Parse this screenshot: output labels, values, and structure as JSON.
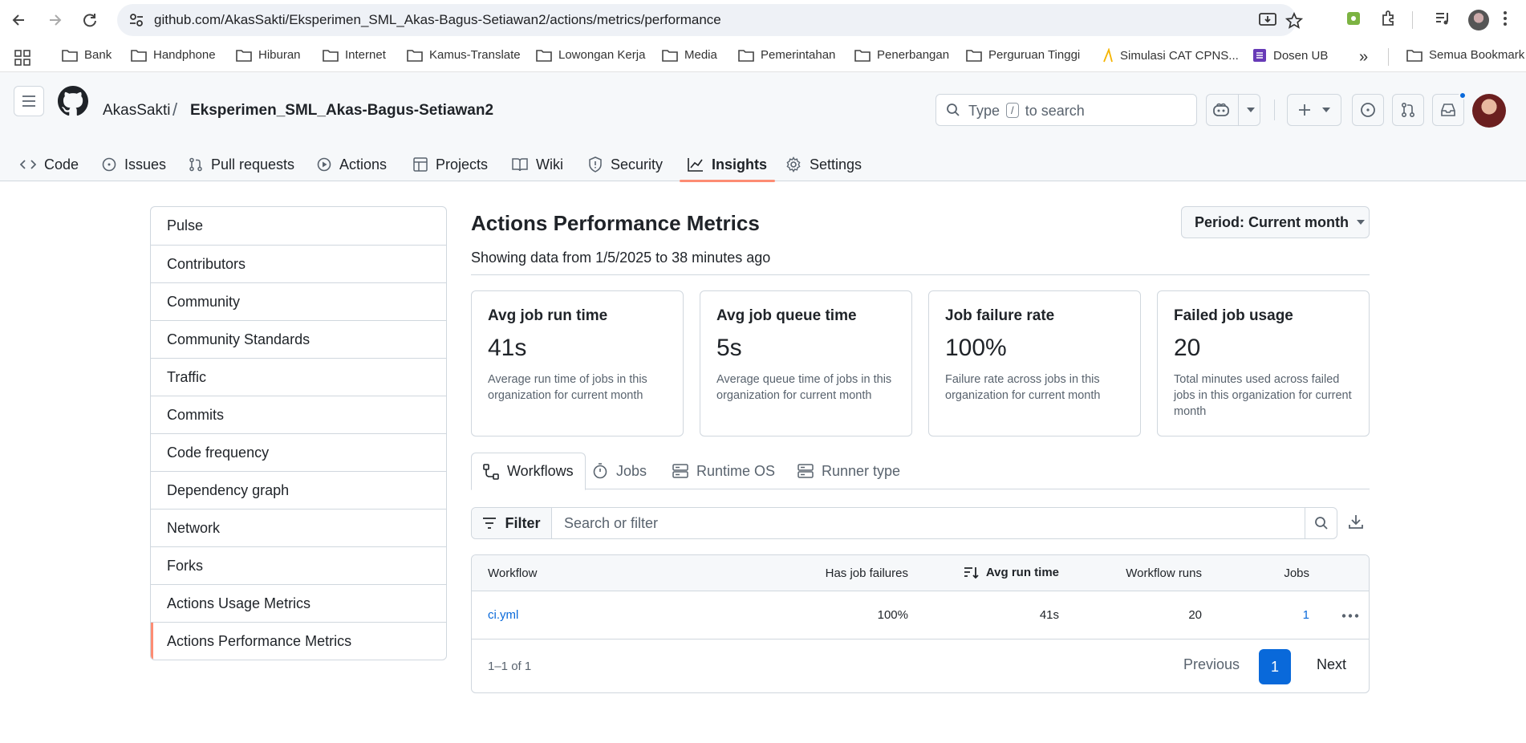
{
  "browser": {
    "url": "github.com/AkasSakti/Eksperimen_SML_Akas-Bagus-Setiawan2/actions/metrics/performance",
    "bookmarks": [
      "Bank",
      "Handphone",
      "Hiburan",
      "Internet",
      "Kamus-Translate",
      "Lowongan Kerja",
      "Media",
      "Pemerintahan",
      "Penerbangan",
      "Perguruan Tinggi",
      "Simulasi CAT CPNS...",
      "Dosen UB"
    ],
    "bookmarks_overflow": "»",
    "all_bookmarks": "Semua Bookmark"
  },
  "header": {
    "owner": "AkasSakti",
    "separator": "/",
    "repo": "Eksperimen_SML_Akas-Bagus-Setiawan2",
    "search_prefix": "Type",
    "search_key": "/",
    "search_suffix": "to search"
  },
  "repo_nav": {
    "tabs": [
      {
        "label": "Code",
        "icon": "code-icon"
      },
      {
        "label": "Issues",
        "icon": "issue-icon"
      },
      {
        "label": "Pull requests",
        "icon": "pull-request-icon"
      },
      {
        "label": "Actions",
        "icon": "play-icon"
      },
      {
        "label": "Projects",
        "icon": "table-icon"
      },
      {
        "label": "Wiki",
        "icon": "book-icon"
      },
      {
        "label": "Security",
        "icon": "shield-icon"
      },
      {
        "label": "Insights",
        "icon": "graph-icon",
        "active": true
      },
      {
        "label": "Settings",
        "icon": "gear-icon"
      }
    ]
  },
  "sidebar": {
    "items": [
      "Pulse",
      "Contributors",
      "Community",
      "Community Standards",
      "Traffic",
      "Commits",
      "Code frequency",
      "Dependency graph",
      "Network",
      "Forks",
      "Actions Usage Metrics",
      "Actions Performance Metrics"
    ],
    "active": "Actions Performance Metrics"
  },
  "main": {
    "title": "Actions Performance Metrics",
    "subtitle": "Showing data from 1/5/2025 to 38 minutes ago",
    "period_label": "Period: Current month",
    "cards": [
      {
        "title": "Avg job run time",
        "value": "41s",
        "desc": "Average run time of jobs in this organization for current month"
      },
      {
        "title": "Avg job queue time",
        "value": "5s",
        "desc": "Average queue time of jobs in this organization for current month"
      },
      {
        "title": "Job failure rate",
        "value": "100%",
        "desc": "Failure rate across jobs in this organization for current month"
      },
      {
        "title": "Failed job usage",
        "value": "20",
        "desc": "Total minutes used across failed jobs in this organization for current month"
      }
    ],
    "tabs": [
      "Workflows",
      "Jobs",
      "Runtime OS",
      "Runner type"
    ],
    "filter_label": "Filter",
    "filter_placeholder": "Search or filter",
    "table": {
      "columns": [
        "Workflow",
        "Has job failures",
        "Avg run time",
        "Workflow runs",
        "Jobs"
      ],
      "rows": [
        {
          "workflow": "ci.yml",
          "failures": "100%",
          "avg_run_time": "41s",
          "runs": "20",
          "jobs": "1"
        }
      ],
      "range": "1–1 of 1",
      "previous": "Previous",
      "page": "1",
      "next": "Next"
    }
  },
  "colors": {
    "accent_underline": "#fd8c73",
    "link": "#0969da",
    "current_page": "#0969da"
  }
}
